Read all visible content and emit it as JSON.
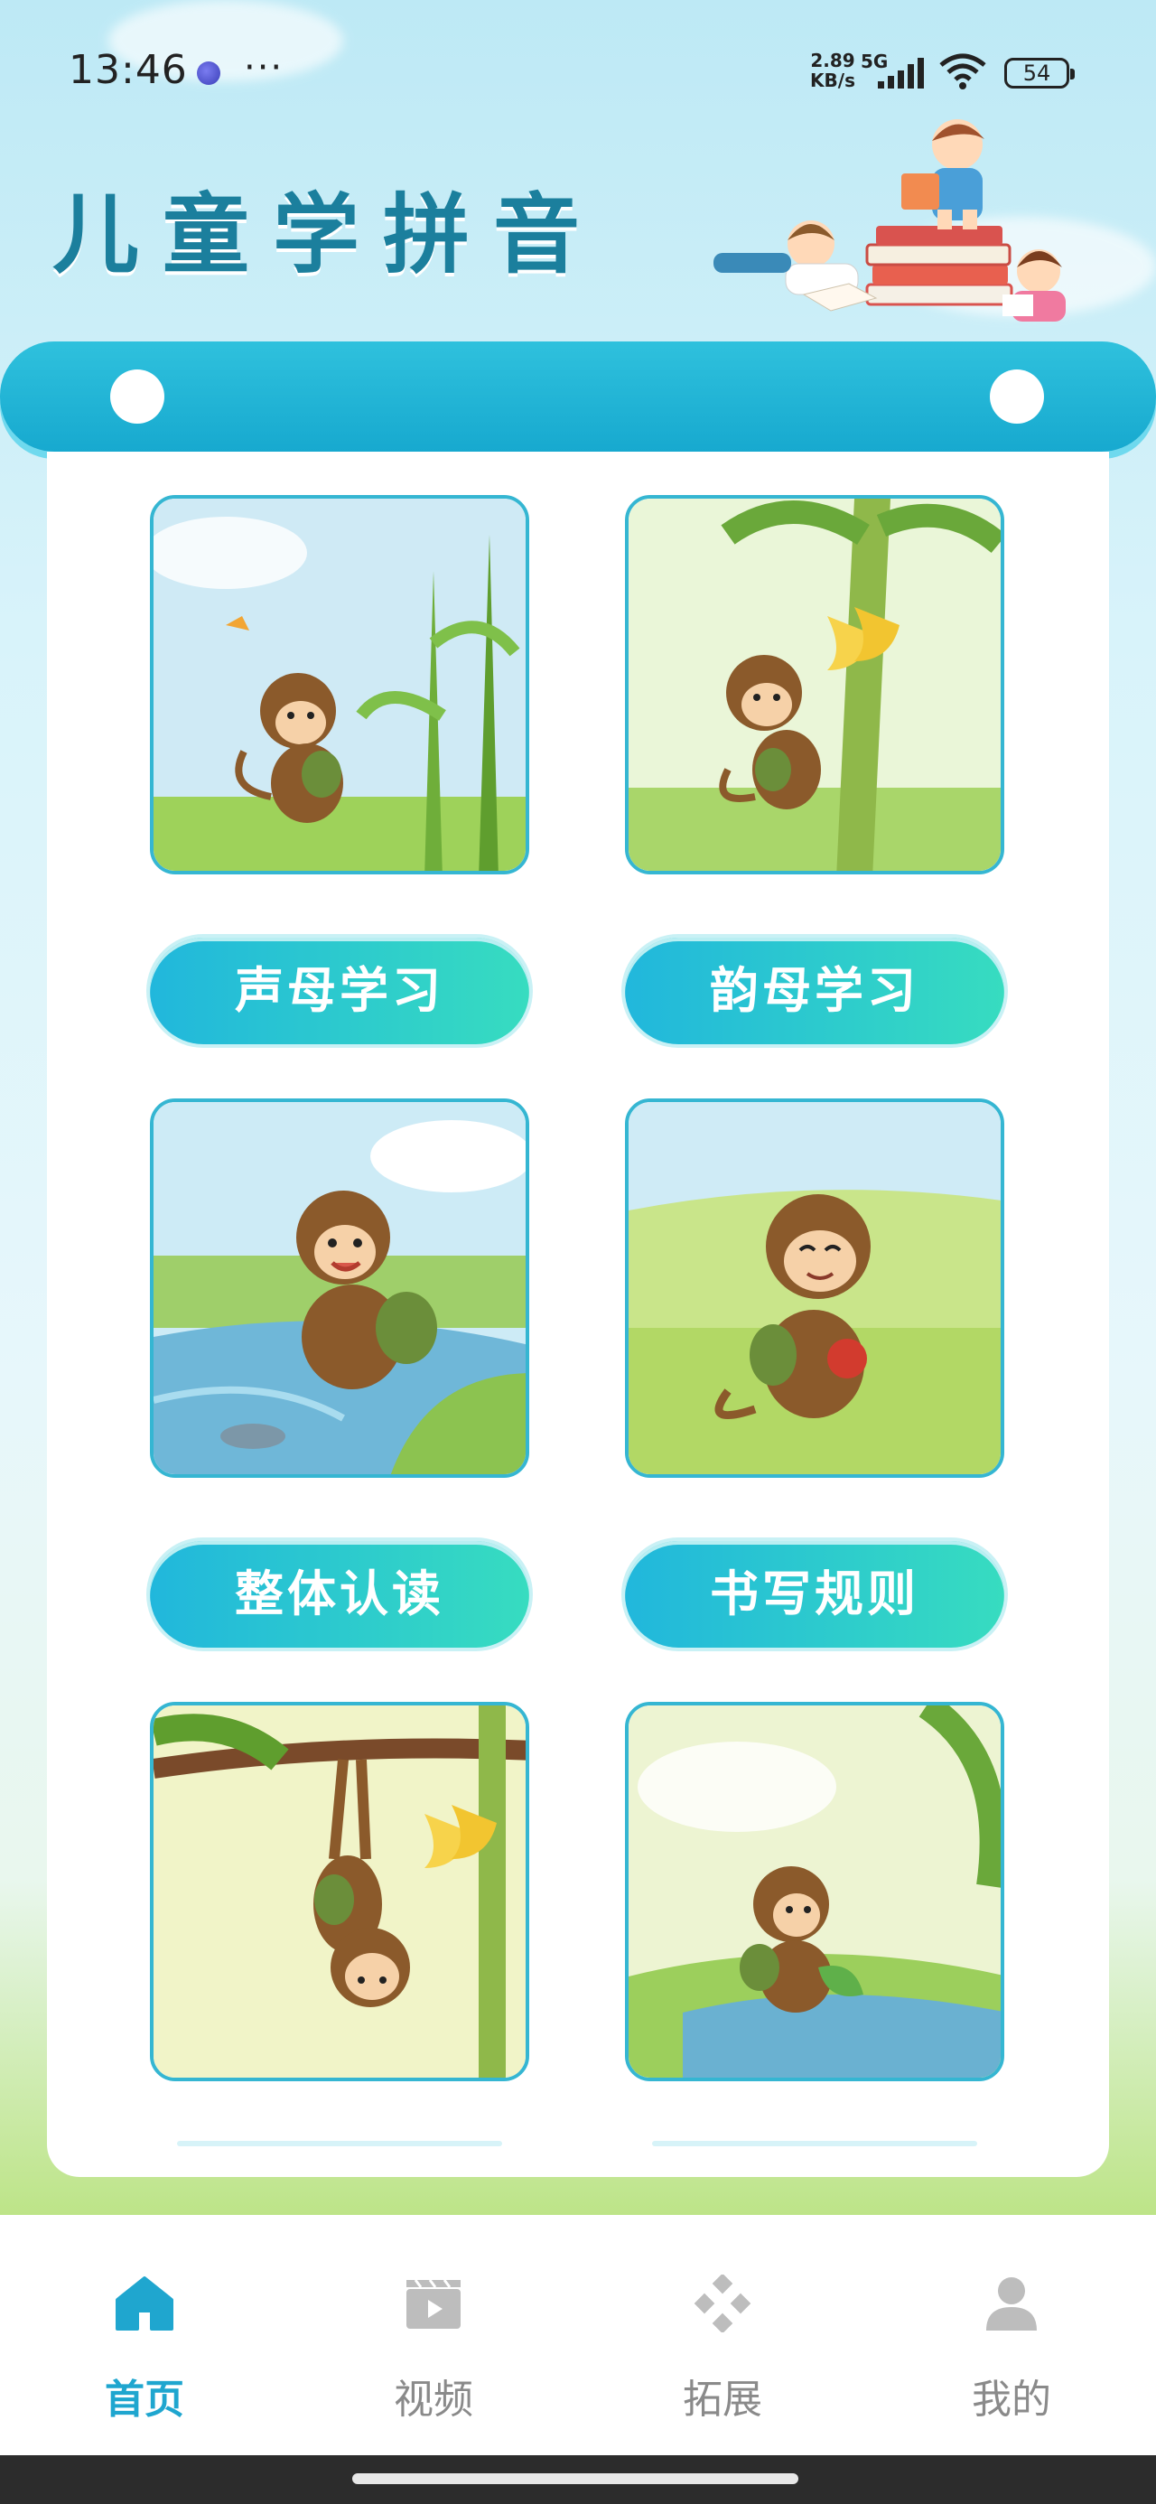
{
  "status_bar": {
    "time": "13:46",
    "more": "···",
    "net_speed_value": "2.89",
    "net_speed_unit": "KB/s",
    "network_type": "5G",
    "battery": "54"
  },
  "header": {
    "title": "儿童学拼音"
  },
  "menu": [
    {
      "label": "声母学习",
      "image": "monkey-walking-in-cornfield"
    },
    {
      "label": "韵母学习",
      "image": "monkey-climbing-banana-tree"
    },
    {
      "label": "整体认读",
      "image": "monkey-by-river-with-fish"
    },
    {
      "label": "书写规则",
      "image": "monkey-holding-apple"
    },
    {
      "label": "",
      "image": "monkey-hanging-from-branch"
    },
    {
      "label": "",
      "image": "monkey-at-stream-with-leaf"
    }
  ],
  "tabbar": {
    "items": [
      {
        "label": "首页",
        "icon": "home-icon",
        "active": true
      },
      {
        "label": "视频",
        "icon": "video-icon",
        "active": false
      },
      {
        "label": "拓展",
        "icon": "expand-icon",
        "active": false
      },
      {
        "label": "我的",
        "icon": "person-icon",
        "active": false
      }
    ]
  },
  "colors": {
    "accent": "#1fa6cf",
    "banner": "#17a9cf",
    "button_start": "#21b7dc",
    "button_end": "#37dcc0",
    "tile_border": "#35b6d2"
  }
}
